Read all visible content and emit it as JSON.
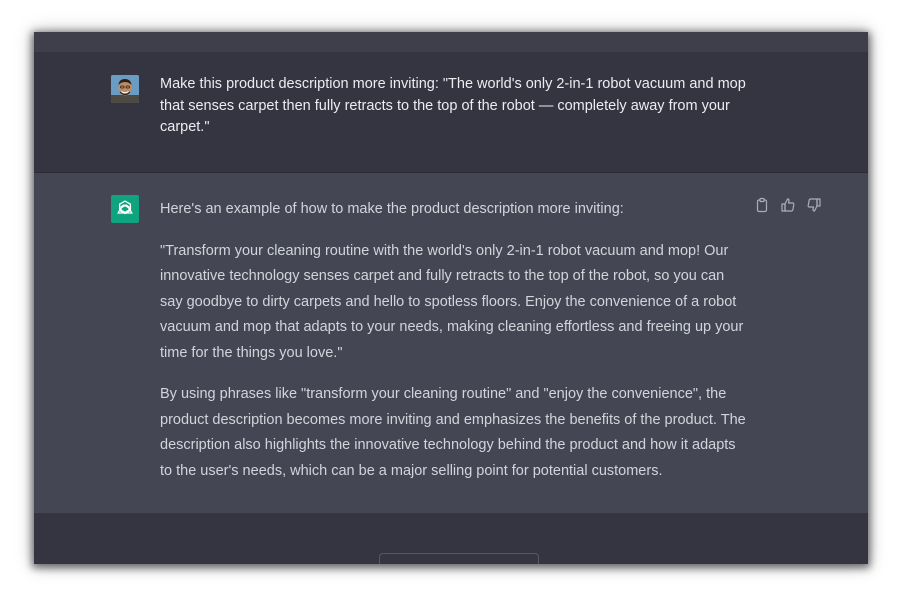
{
  "user": {
    "message": "Make this product description more inviting: \"The world's only 2-in-1 robot vacuum and mop that senses carpet then fully retracts to the top of the robot — completely away from your carpet.\""
  },
  "assistant": {
    "intro": "Here's an example of how to make the product description more inviting:",
    "paragraph1": "\"Transform your cleaning routine with the world's only 2-in-1 robot vacuum and mop! Our innovative technology senses carpet and fully retracts to the top of the robot, so you can say goodbye to dirty carpets and hello to spotless floors. Enjoy the convenience of a robot vacuum and mop that adapts to your needs, making cleaning effortless and freeing up your time for the things you love.\"",
    "paragraph2": "By using phrases like \"transform your cleaning routine\" and \"enjoy the convenience\", the product description becomes more inviting and emphasizes the benefits of the product. The description also highlights the innovative technology behind the product and how it adapts to the user's needs, which can be a major selling point for potential customers."
  },
  "icons": {
    "copy": "clipboard-icon",
    "thumbs_up": "thumbs-up-icon",
    "thumbs_down": "thumbs-down-icon",
    "assistant_logo": "openai-logo-icon"
  },
  "colors": {
    "user_bg": "#343541",
    "assistant_bg": "#444654",
    "logo_bg": "#10a37f",
    "text": "#d1d5db"
  }
}
